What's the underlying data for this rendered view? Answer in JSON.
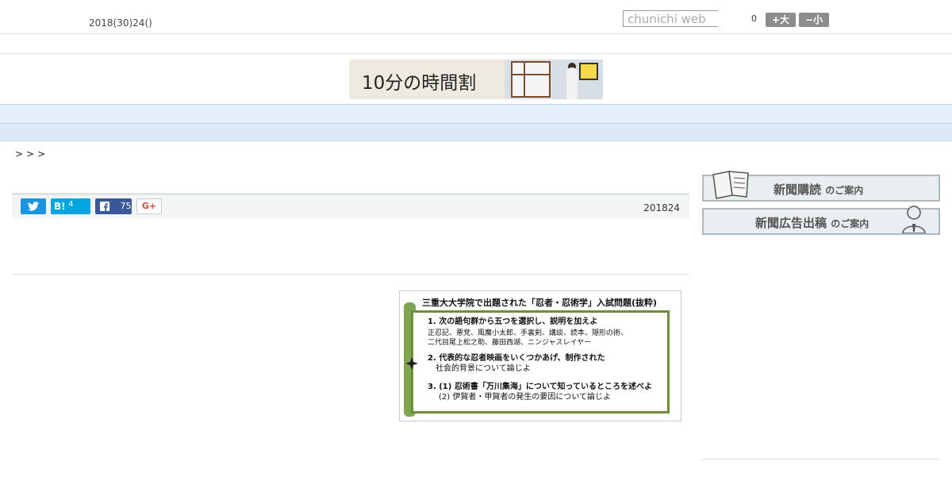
{
  "header": {
    "date": "2018(30)24()",
    "search_placeholder": "chunichi web",
    "counter": "0",
    "font_large": "+大",
    "font_small": "−小"
  },
  "banner": {
    "text": "10分の時間割"
  },
  "nav": {
    "items": [
      "　　",
      "　　",
      "　　",
      "　　",
      "　　",
      "　　",
      "　　",
      "　　",
      "　　"
    ]
  },
  "breadcrumb": ">>>",
  "share": {
    "hatena_label": "B!",
    "hatena_count": "4",
    "facebook_count": "75",
    "gplus_label": "G+",
    "date": "201824"
  },
  "figure": {
    "title": "三重大大学院で出題された「忍者・忍術学」入試問題(抜粋)",
    "q1": "1. 次の語句群から五つを選択し、説明を加えよ",
    "q1_words_a": "正忍記、悪党、風魔小太郎、手裏剣、講談、読本、隠形の術、",
    "q1_words_b": "二代目尾上松之助、藤田西湖、ニンジャスレイヤー",
    "q2_a": "2. 代表的な忍者映画をいくつかあげ、制作された",
    "q2_b": "社会的背景について論じよ",
    "q3_a": "3. (1) 忍術書「万川集海」について知っているところを述べよ",
    "q3_b": "(2) 伊賀者・甲賀者の発生の要因について論じよ"
  },
  "sidebar": {
    "ad1_main": "新聞購読",
    "ad1_sub": "のご案内",
    "ad2_main": "新聞広告出稿",
    "ad2_sub": "のご案内"
  },
  "colors": {
    "nav_bg": "#e6f0fa",
    "twitter": "#1b95e0",
    "hatena": "#00a4de",
    "facebook": "#3b5998",
    "scroll_green": "#6b8f3a"
  }
}
